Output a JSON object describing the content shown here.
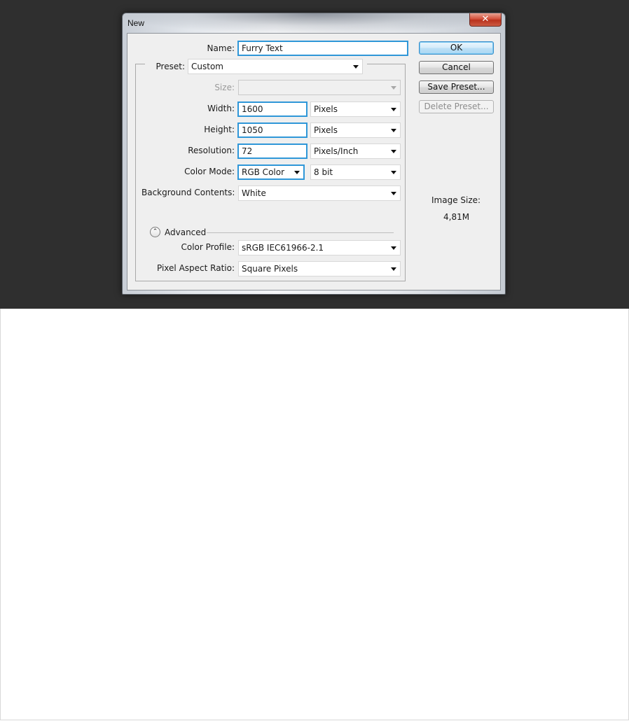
{
  "window": {
    "title": "New",
    "close_glyph": "✕"
  },
  "form": {
    "name_label": "Name:",
    "name_value": "Furry Text",
    "preset_label": "Preset:",
    "preset_value": "Custom",
    "size_label": "Size:",
    "size_value": "",
    "width_label": "Width:",
    "width_value": "1600",
    "width_unit": "Pixels",
    "height_label": "Height:",
    "height_value": "1050",
    "height_unit": "Pixels",
    "resolution_label": "Resolution:",
    "resolution_value": "72",
    "resolution_unit": "Pixels/Inch",
    "color_mode_label": "Color Mode:",
    "color_mode_value": "RGB Color",
    "bit_depth_value": "8 bit",
    "background_label": "Background Contents:",
    "background_value": "White",
    "advanced_label": "Advanced",
    "advanced_icon": "chevron-up-double-icon",
    "advanced_glyph": "⌃",
    "color_profile_label": "Color Profile:",
    "color_profile_value": "sRGB IEC61966-2.1",
    "pixel_aspect_label": "Pixel Aspect Ratio:",
    "pixel_aspect_value": "Square Pixels"
  },
  "buttons": {
    "ok": "OK",
    "cancel": "Cancel",
    "save_preset": "Save Preset...",
    "delete_preset": "Delete Preset..."
  },
  "image_size": {
    "label": "Image Size:",
    "value": "4,81M"
  },
  "colors": {
    "focus_border": "#2f97d8",
    "backdrop": "#2f2f2f",
    "close_button": "#c7402a"
  }
}
